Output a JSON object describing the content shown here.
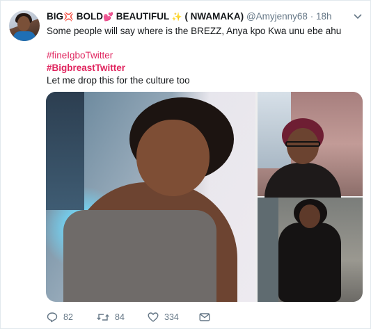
{
  "tweet": {
    "author": {
      "name_part1": "BIG",
      "name_part2": "BOLD",
      "name_part3": "BEAUTIFUL",
      "name_part4": "( NWAMAKA)",
      "emoji1": "💢",
      "emoji2": "💕",
      "emoji3": "✨",
      "handle": "@Amyjenny68",
      "separator": "·",
      "time": "18h"
    },
    "text_line1": "Some people will say where is the BREZZ, Anya kpo Kwa unu ebe ahu",
    "hashtag1": "#fineIgboTwitter",
    "hashtag2": "#BigbreastTwitter",
    "text_line3": "Let me drop this for the culture too",
    "actions": {
      "replies": "82",
      "retweets": "84",
      "likes": "334"
    }
  },
  "icons": {
    "avatar": "avatar",
    "menu": "chevron-down-icon",
    "reply": "reply-icon",
    "retweet": "retweet-icon",
    "like": "heart-icon",
    "dm": "envelope-icon"
  },
  "colors": {
    "text": "#14171a",
    "secondary": "#657786",
    "hashtag": "#e0245e",
    "border": "#e1e8ed"
  }
}
